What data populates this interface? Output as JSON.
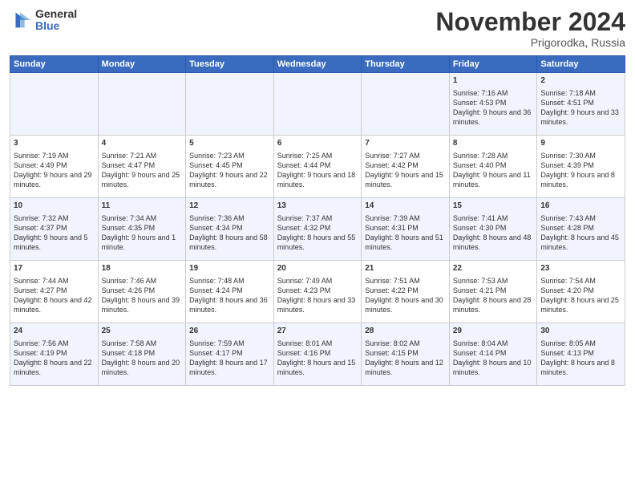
{
  "logo": {
    "general": "General",
    "blue": "Blue"
  },
  "header": {
    "month": "November 2024",
    "location": "Prigorodka, Russia"
  },
  "days_of_week": [
    "Sunday",
    "Monday",
    "Tuesday",
    "Wednesday",
    "Thursday",
    "Friday",
    "Saturday"
  ],
  "weeks": [
    [
      {
        "day": "",
        "content": ""
      },
      {
        "day": "",
        "content": ""
      },
      {
        "day": "",
        "content": ""
      },
      {
        "day": "",
        "content": ""
      },
      {
        "day": "",
        "content": ""
      },
      {
        "day": "1",
        "content": "Sunrise: 7:16 AM\nSunset: 4:53 PM\nDaylight: 9 hours and 36 minutes."
      },
      {
        "day": "2",
        "content": "Sunrise: 7:18 AM\nSunset: 4:51 PM\nDaylight: 9 hours and 33 minutes."
      }
    ],
    [
      {
        "day": "3",
        "content": "Sunrise: 7:19 AM\nSunset: 4:49 PM\nDaylight: 9 hours and 29 minutes."
      },
      {
        "day": "4",
        "content": "Sunrise: 7:21 AM\nSunset: 4:47 PM\nDaylight: 9 hours and 25 minutes."
      },
      {
        "day": "5",
        "content": "Sunrise: 7:23 AM\nSunset: 4:45 PM\nDaylight: 9 hours and 22 minutes."
      },
      {
        "day": "6",
        "content": "Sunrise: 7:25 AM\nSunset: 4:44 PM\nDaylight: 9 hours and 18 minutes."
      },
      {
        "day": "7",
        "content": "Sunrise: 7:27 AM\nSunset: 4:42 PM\nDaylight: 9 hours and 15 minutes."
      },
      {
        "day": "8",
        "content": "Sunrise: 7:28 AM\nSunset: 4:40 PM\nDaylight: 9 hours and 11 minutes."
      },
      {
        "day": "9",
        "content": "Sunrise: 7:30 AM\nSunset: 4:39 PM\nDaylight: 9 hours and 8 minutes."
      }
    ],
    [
      {
        "day": "10",
        "content": "Sunrise: 7:32 AM\nSunset: 4:37 PM\nDaylight: 9 hours and 5 minutes."
      },
      {
        "day": "11",
        "content": "Sunrise: 7:34 AM\nSunset: 4:35 PM\nDaylight: 9 hours and 1 minute."
      },
      {
        "day": "12",
        "content": "Sunrise: 7:36 AM\nSunset: 4:34 PM\nDaylight: 8 hours and 58 minutes."
      },
      {
        "day": "13",
        "content": "Sunrise: 7:37 AM\nSunset: 4:32 PM\nDaylight: 8 hours and 55 minutes."
      },
      {
        "day": "14",
        "content": "Sunrise: 7:39 AM\nSunset: 4:31 PM\nDaylight: 8 hours and 51 minutes."
      },
      {
        "day": "15",
        "content": "Sunrise: 7:41 AM\nSunset: 4:30 PM\nDaylight: 8 hours and 48 minutes."
      },
      {
        "day": "16",
        "content": "Sunrise: 7:43 AM\nSunset: 4:28 PM\nDaylight: 8 hours and 45 minutes."
      }
    ],
    [
      {
        "day": "17",
        "content": "Sunrise: 7:44 AM\nSunset: 4:27 PM\nDaylight: 8 hours and 42 minutes."
      },
      {
        "day": "18",
        "content": "Sunrise: 7:46 AM\nSunset: 4:26 PM\nDaylight: 8 hours and 39 minutes."
      },
      {
        "day": "19",
        "content": "Sunrise: 7:48 AM\nSunset: 4:24 PM\nDaylight: 8 hours and 36 minutes."
      },
      {
        "day": "20",
        "content": "Sunrise: 7:49 AM\nSunset: 4:23 PM\nDaylight: 8 hours and 33 minutes."
      },
      {
        "day": "21",
        "content": "Sunrise: 7:51 AM\nSunset: 4:22 PM\nDaylight: 8 hours and 30 minutes."
      },
      {
        "day": "22",
        "content": "Sunrise: 7:53 AM\nSunset: 4:21 PM\nDaylight: 8 hours and 28 minutes."
      },
      {
        "day": "23",
        "content": "Sunrise: 7:54 AM\nSunset: 4:20 PM\nDaylight: 8 hours and 25 minutes."
      }
    ],
    [
      {
        "day": "24",
        "content": "Sunrise: 7:56 AM\nSunset: 4:19 PM\nDaylight: 8 hours and 22 minutes."
      },
      {
        "day": "25",
        "content": "Sunrise: 7:58 AM\nSunset: 4:18 PM\nDaylight: 8 hours and 20 minutes."
      },
      {
        "day": "26",
        "content": "Sunrise: 7:59 AM\nSunset: 4:17 PM\nDaylight: 8 hours and 17 minutes."
      },
      {
        "day": "27",
        "content": "Sunrise: 8:01 AM\nSunset: 4:16 PM\nDaylight: 8 hours and 15 minutes."
      },
      {
        "day": "28",
        "content": "Sunrise: 8:02 AM\nSunset: 4:15 PM\nDaylight: 8 hours and 12 minutes."
      },
      {
        "day": "29",
        "content": "Sunrise: 8:04 AM\nSunset: 4:14 PM\nDaylight: 8 hours and 10 minutes."
      },
      {
        "day": "30",
        "content": "Sunrise: 8:05 AM\nSunset: 4:13 PM\nDaylight: 8 hours and 8 minutes."
      }
    ]
  ]
}
